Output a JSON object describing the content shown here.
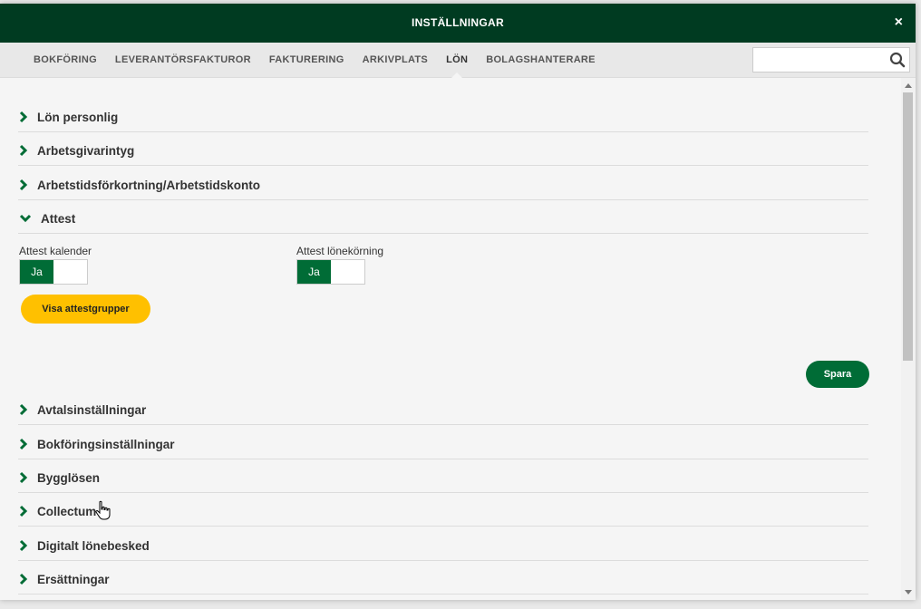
{
  "window": {
    "title": "INSTÄLLNINGAR",
    "close_label": "×"
  },
  "tabs": [
    {
      "label": "BOKFÖRING"
    },
    {
      "label": "LEVERANTÖRSFAKTUROR"
    },
    {
      "label": "FAKTURERING"
    },
    {
      "label": "ARKIVPLATS"
    },
    {
      "label": "LÖN",
      "active": true
    },
    {
      "label": "BOLAGSHANTERARE"
    }
  ],
  "search": {
    "value": "",
    "placeholder": "",
    "icon": "search-icon"
  },
  "sections": [
    {
      "label": "Lön personlig",
      "expanded": false
    },
    {
      "label": "Arbetsgivarintyg",
      "expanded": false
    },
    {
      "label": "Arbetstidsförkortning/Arbetstidskonto",
      "expanded": false
    },
    {
      "label": "Attest",
      "expanded": true
    },
    {
      "label": "Avtalsinställningar",
      "expanded": false
    },
    {
      "label": "Bokföringsinställningar",
      "expanded": false
    },
    {
      "label": "Bygglösen",
      "expanded": false
    },
    {
      "label": "Collectum",
      "expanded": false
    },
    {
      "label": "Digitalt lönebesked",
      "expanded": false
    },
    {
      "label": "Ersättningar",
      "expanded": false
    }
  ],
  "attest": {
    "calendar_label": "Attest kalender",
    "calendar_toggle": "Ja",
    "payrun_label": "Attest lönekörning",
    "payrun_toggle": "Ja",
    "show_groups_button": "Visa attestgrupper",
    "save_button": "Spara"
  },
  "colors": {
    "header_bg": "#003b21",
    "accent_green": "#006c36",
    "accent_yellow": "#ffc000"
  }
}
